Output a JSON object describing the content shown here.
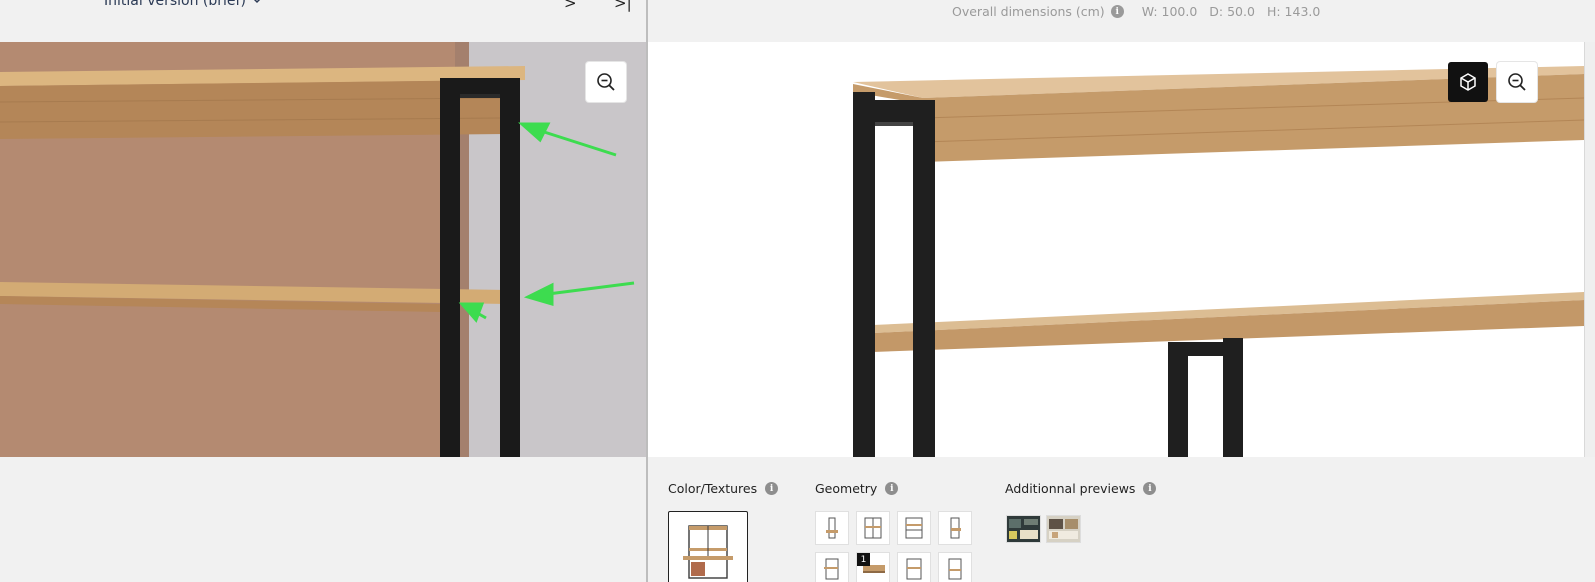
{
  "left_panel": {
    "version_label": "Initial version (brief)",
    "next_label": ">",
    "last_label": ">|"
  },
  "right_panel": {
    "dimensions": {
      "label": "Overall dimensions (cm)",
      "width": "W: 100.0",
      "depth": "D: 50.0",
      "height": "H: 143.0"
    },
    "options": {
      "textures_label": "Color/Textures",
      "geometry_label": "Geometry",
      "previews_label": "Additionnal previews",
      "geometry_badge": "1"
    }
  },
  "colors": {
    "arrow": "#3ddc4f",
    "wood": "#c79a6a",
    "frame": "#1d1d1d",
    "wall": "#b48a71"
  },
  "icons": [
    "chevron-down-icon",
    "chevron-right-icon",
    "skip-to-end-icon",
    "zoom-out-icon",
    "cube-icon",
    "info-icon"
  ]
}
